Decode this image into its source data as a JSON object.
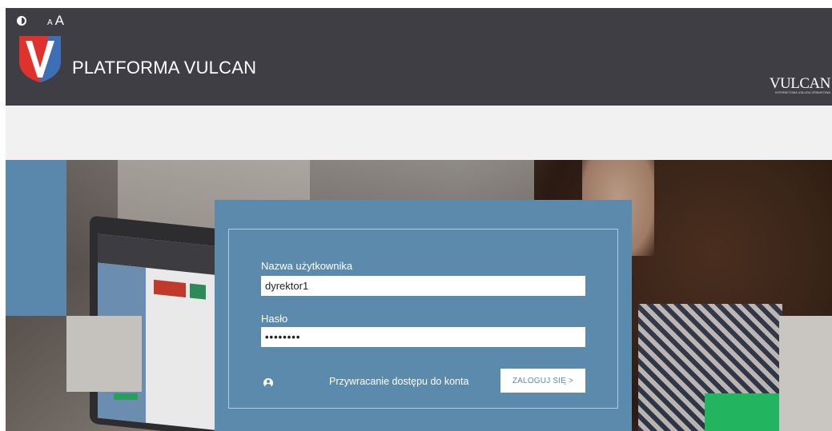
{
  "header": {
    "title": "PLATFORMA VULCAN",
    "brand_name": "VULCAN",
    "brand_tagline": "INTERNETOWA USŁUGA OŚWIATOWA",
    "font_size_small": "A",
    "font_size_large": "A",
    "colors": {
      "bar": "#3f3e44",
      "logo_red": "#e0322d",
      "logo_blue": "#3d6fb6"
    }
  },
  "login": {
    "username_label": "Nazwa użytkownika",
    "username_value": "dyrektor1",
    "password_label": "Hasło",
    "password_value": "••••••••",
    "recover_link": "Przywracanie dostępu do konta",
    "login_button": "ZALOGUJ SIĘ >",
    "colors": {
      "panel": "#5b8aad",
      "accent_green": "#22b45e"
    }
  },
  "icons": [
    "contrast-icon",
    "font-size-icon",
    "user-icon"
  ]
}
